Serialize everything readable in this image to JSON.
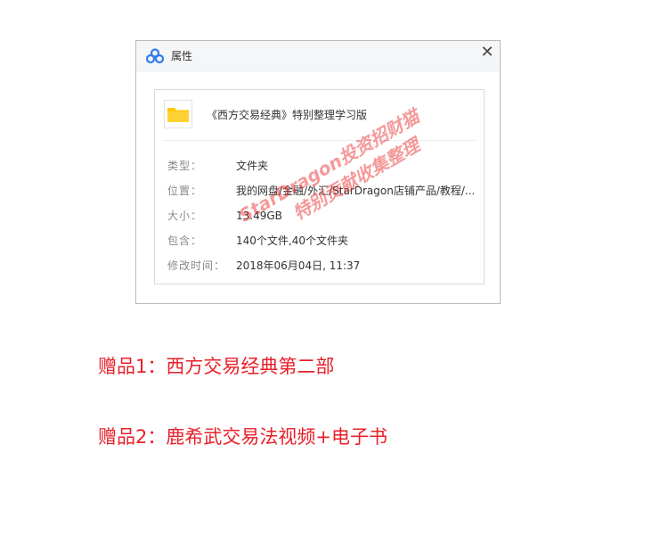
{
  "dialog": {
    "title": "属性",
    "close_glyph": "✕",
    "app_icon": "baidu-netdisk-icon",
    "folder_icon": "folder-icon",
    "folder_name": "《西方交易经典》特别整理学习版",
    "rows": [
      {
        "label": "类型：",
        "value": "文件夹"
      },
      {
        "label": "位置：",
        "value": "我的网盘/金融/外汇/StarDragon店铺产品/教程/..."
      },
      {
        "label": "大小：",
        "value": "13.49GB"
      },
      {
        "label": "包含：",
        "value": "140个文件,40个文件夹"
      },
      {
        "label": "修改时间：",
        "value": "2018年06月04日, 11:37"
      }
    ]
  },
  "watermark": {
    "line1": "StarDragon投资招财猫",
    "line2": "特别贡献收集整理"
  },
  "gifts": [
    "赠品1：西方交易经典第二部",
    "赠品2：鹿希武交易法视频+电子书"
  ],
  "colors": {
    "accent_red": "#e8202a",
    "folder_yellow": "#ffc600",
    "titlebar_bg": "#f5f6f8",
    "icon_blue": "#2f7ef0"
  }
}
